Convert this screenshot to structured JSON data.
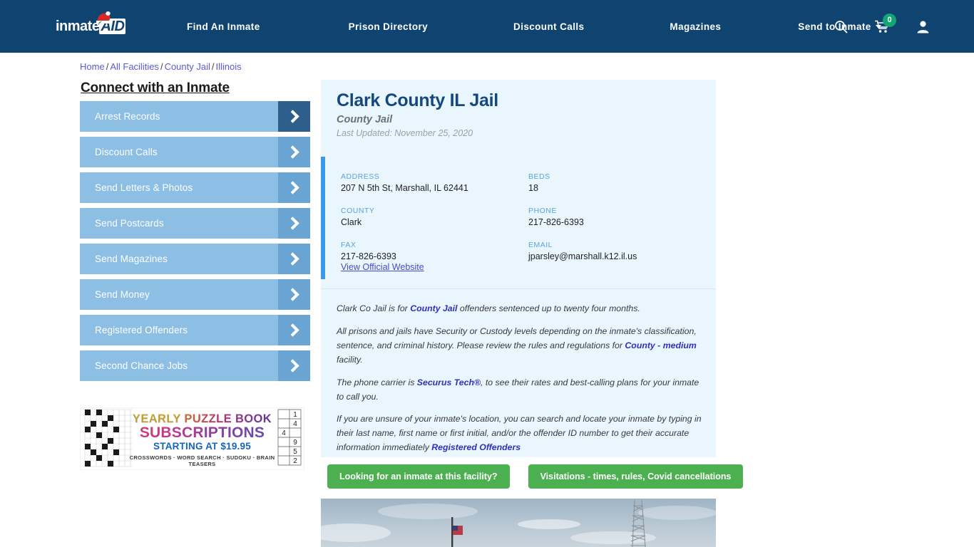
{
  "header": {
    "logo_text": "inmate",
    "logo_accent": "AID",
    "logo_icon": "santa-hat-icon",
    "nav": [
      {
        "label": "Find An Inmate",
        "has_caret": false
      },
      {
        "label": "Prison Directory",
        "has_caret": false
      },
      {
        "label": "Discount Calls",
        "has_caret": false
      },
      {
        "label": "Magazines",
        "has_caret": false
      },
      {
        "label": "Send to Inmate",
        "has_caret": true
      }
    ],
    "icons": {
      "search": "search-icon",
      "cart": "cart-icon",
      "cart_count": "0",
      "account": "user-account-icon"
    },
    "bg_color": "#0f4471",
    "badge_color": "#13a574"
  },
  "breadcrumb": {
    "items": [
      "Home",
      "All Facilities",
      "County Jail",
      "Illinois"
    ],
    "separator": "/"
  },
  "sidebar": {
    "title": "Connect with an Inmate",
    "items": [
      {
        "label": "Arrest Records",
        "active": true
      },
      {
        "label": "Discount Calls",
        "active": false
      },
      {
        "label": "Send Letters & Photos",
        "active": false
      },
      {
        "label": "Send Postcards",
        "active": false
      },
      {
        "label": "Send Magazines",
        "active": false
      },
      {
        "label": "Send Money",
        "active": false
      },
      {
        "label": "Registered Offenders",
        "active": false
      },
      {
        "label": "Second Chance Jobs",
        "active": false
      }
    ],
    "arrow_icon": "chevron-right-icon"
  },
  "ad": {
    "line1": "YEARLY PUZZLE BOOK",
    "line2": "SUBSCRIPTIONS",
    "line3": "STARTING AT $19.95",
    "line4": "CROSSWORDS · WORD SEARCH · SUDOKU · BRAIN TEASERS",
    "sudoku_digits": [
      "1",
      "4",
      "4",
      "9",
      "5",
      "2"
    ]
  },
  "facility": {
    "title": "Clark County IL Jail",
    "subtitle": "County Jail",
    "last_updated": "Last Updated: November 25, 2020",
    "fields": [
      {
        "label": "ADDRESS",
        "value": "207 N 5th St, Marshall, IL 62441"
      },
      {
        "label": "BEDS",
        "value": "18"
      },
      {
        "label": "COUNTY",
        "value": "Clark"
      },
      {
        "label": "PHONE",
        "value": "217-826-6393"
      },
      {
        "label": "FAX",
        "value": "217-826-6393"
      },
      {
        "label": "EMAIL",
        "value": "jparsley@marshall.k12.il.us"
      }
    ],
    "official_website_label": "View Official Website",
    "accent_color": "#3a9ae8",
    "panel_color": "#eaf6fd"
  },
  "body": {
    "p1_a": "Clark Co Jail is for ",
    "p1_link": "County Jail",
    "p1_b": " offenders sentenced up to twenty four months.",
    "p2_a": "All prisons and jails have Security or Custody levels depending on the inmate's classification, sentence, and criminal history. Please review the rules and regulations for ",
    "p2_link": "County - medium",
    "p2_b": " facility.",
    "p3_a": "The phone carrier is ",
    "p3_link": "Securus Tech®",
    "p3_b": ", to see their rates and best-calling plans for your inmate to call you.",
    "p4_a": "If you are unsure of your inmate's location, you can search and locate your inmate by typing in their last name, first name or first initial, and/or the offender ID number to get their accurate information immediately ",
    "p4_link": "Registered Offenders"
  },
  "cta": {
    "color": "#4caf50",
    "buttons": [
      "Looking for an inmate at this facility?",
      "Visitations - times, rules, Covid cancellations"
    ]
  },
  "photo": {
    "description": "facility-exterior-photo"
  }
}
